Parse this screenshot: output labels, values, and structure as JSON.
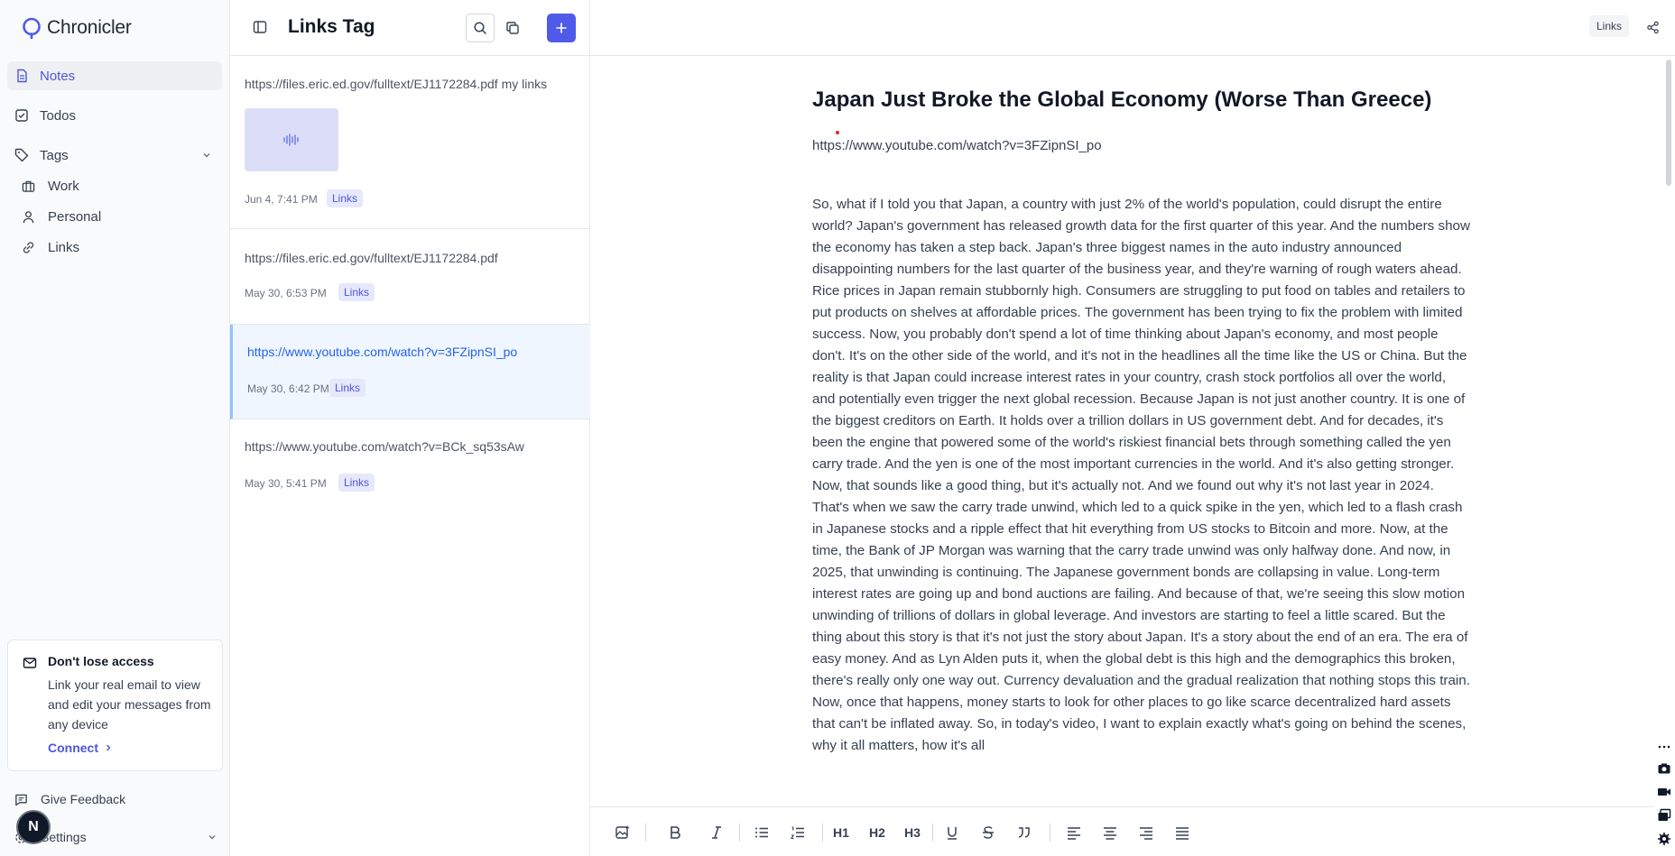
{
  "app": {
    "name": "Chronicler",
    "avatar_initial": "N"
  },
  "sidebar": {
    "nav": [
      {
        "label": "Notes"
      },
      {
        "label": "Todos"
      },
      {
        "label": "Tags"
      }
    ],
    "tags": [
      {
        "label": "Work"
      },
      {
        "label": "Personal"
      },
      {
        "label": "Links"
      }
    ],
    "access_card": {
      "title": "Don't lose access",
      "description": "Link your real email to view and edit your messages from any device",
      "connect": "Connect"
    },
    "feedback": "Give Feedback",
    "settings": "Settings"
  },
  "list": {
    "title": "Links Tag",
    "notes": [
      {
        "url": "https://files.eric.ed.gov/fulltext/EJ1172284.pdf my links",
        "date": "Jun 4, 7:41 PM",
        "tag": "Links"
      },
      {
        "url": "https://files.eric.ed.gov/fulltext/EJ1172284.pdf",
        "date": "May 30, 6:53 PM",
        "tag": "Links"
      },
      {
        "url": "https://www.youtube.com/watch?v=3FZipnSI_po",
        "date": "May 30, 6:42 PM",
        "tag": "Links"
      },
      {
        "url": "https://www.youtube.com/watch?v=BCk_sq53sAw",
        "date": "May 30, 5:41 PM",
        "tag": "Links"
      }
    ]
  },
  "editor": {
    "tag_badge": "Links",
    "title": "Japan Just Broke the Global Economy (Worse Than Greece)",
    "link": "https://www.youtube.com/watch?v=3FZipnSI_po",
    "body": "So, what if I told you that Japan, a country with just 2% of the world's population, could disrupt the entire world? Japan's government has released growth data for the first quarter of this year. And the numbers show the economy has taken a step back. Japan's three biggest names in the auto industry announced disappointing numbers for the last quarter of the business year, and they're warning of rough waters ahead. Rice prices in Japan remain stubbornly high. Consumers are struggling to put food on tables and retailers to put products on shelves at affordable prices. The government has been trying to fix the problem with limited success. Now, you probably don't spend a lot of time thinking about Japan's economy, and most people don't. It's on the other side of the world, and it's not in the headlines all the time like the US or China. But the reality is that Japan could increase interest rates in your country, crash stock portfolios all over the world, and potentially even trigger the next global recession. Because Japan is not just another country. It is one of the biggest creditors on Earth. It holds over a trillion dollars in US government debt. And for decades, it's been the engine that powered some of the world's riskiest financial bets through something called the yen carry trade. And the yen is one of the most important currencies in the world. And it's also getting stronger. Now, that sounds like a good thing, but it's actually not. And we found out why it's not last year in 2024. That's when we saw the carry trade unwind, which led to a quick spike in the yen, which led to a flash crash in Japanese stocks and a ripple effect that hit everything from US stocks to Bitcoin and more. Now, at the time, the Bank of JP Morgan was warning that the carry trade unwind was only halfway done. And now, in 2025, that unwinding is continuing. The Japanese government bonds are collapsing in value. Long-term interest rates are going up and bond auctions are failing. And because of that, we're seeing this slow motion unwinding of trillions of dollars in global leverage. And investors are starting to feel a little scared. But the thing about this story is that it's not just the story about Japan. It's a story about the end of an era. The era of easy money. And as Lyn Alden puts it, when the global debt is this high and the demographics this broken, there's really only one way out. Currency devaluation and the gradual realization that nothing stops this train. Now, once that happens, money starts to look for other places to go like scarce decentralized hard assets that can't be inflated away. So, in today's video, I want to explain exactly what's going on behind the scenes, why it all matters, how it's all",
    "toolbar": {
      "h1": "H1",
      "h2": "H2",
      "h3": "H3"
    }
  },
  "colors": {
    "accent": "#4f5be8",
    "tag_bg": "#e6e8fb",
    "selected_bg": "#eff6ff"
  }
}
